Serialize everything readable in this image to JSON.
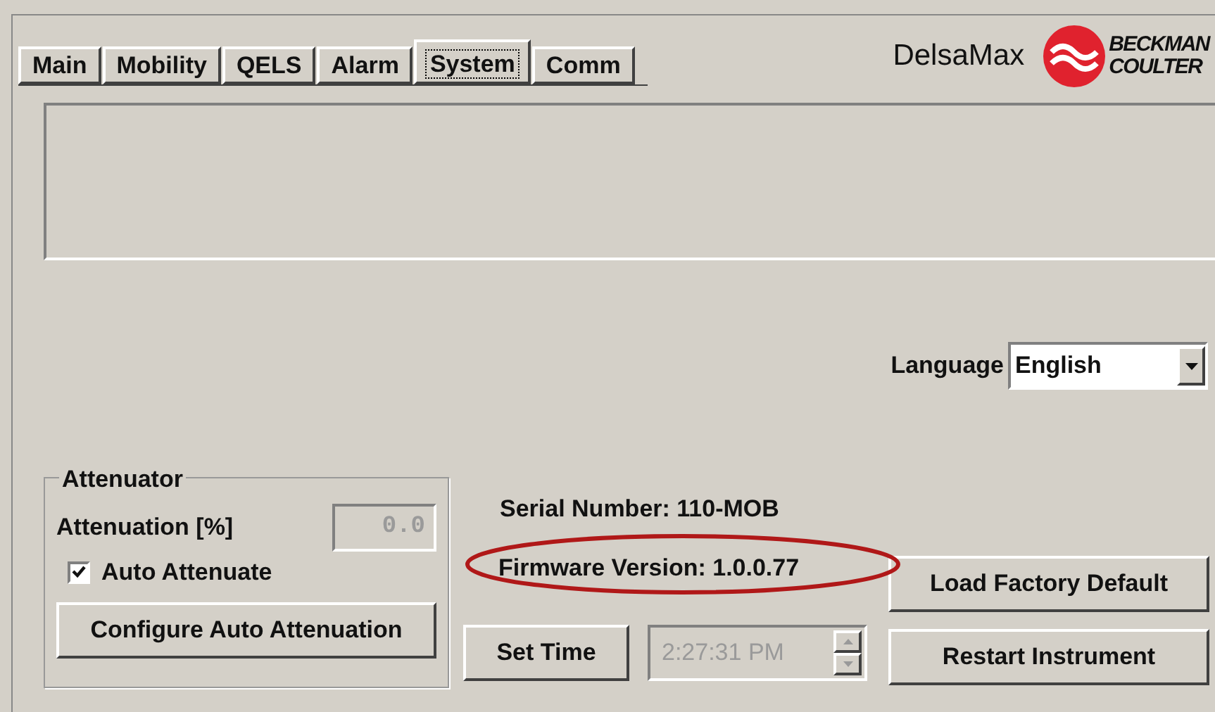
{
  "tabs": [
    {
      "label": "Main",
      "selected": false
    },
    {
      "label": "Mobility",
      "selected": false
    },
    {
      "label": "QELS",
      "selected": false
    },
    {
      "label": "Alarm",
      "selected": false
    },
    {
      "label": "System",
      "selected": true
    },
    {
      "label": "Comm",
      "selected": false
    }
  ],
  "brand": {
    "product": "DelsaMax",
    "logo_line_1": "BECKMAN",
    "logo_line_2": "COULTER"
  },
  "language": {
    "label": "Language",
    "value": "English"
  },
  "attenuator": {
    "title": "Attenuator",
    "field_label": "Attenuation [%]",
    "value": "0.0",
    "disabled": true,
    "auto": {
      "label": "Auto Attenuate",
      "checked": true
    },
    "button": "Configure Auto Attenuation"
  },
  "info": {
    "serial": "Serial Number: 110-MOB",
    "firmware": "Firmware Version: 1.0.0.77",
    "firmware_highlighted": true
  },
  "time": {
    "button": "Set Time",
    "value": "2:27:31 PM",
    "disabled": true
  },
  "buttons": [
    "Load Factory Default",
    "Restart Instrument"
  ]
}
